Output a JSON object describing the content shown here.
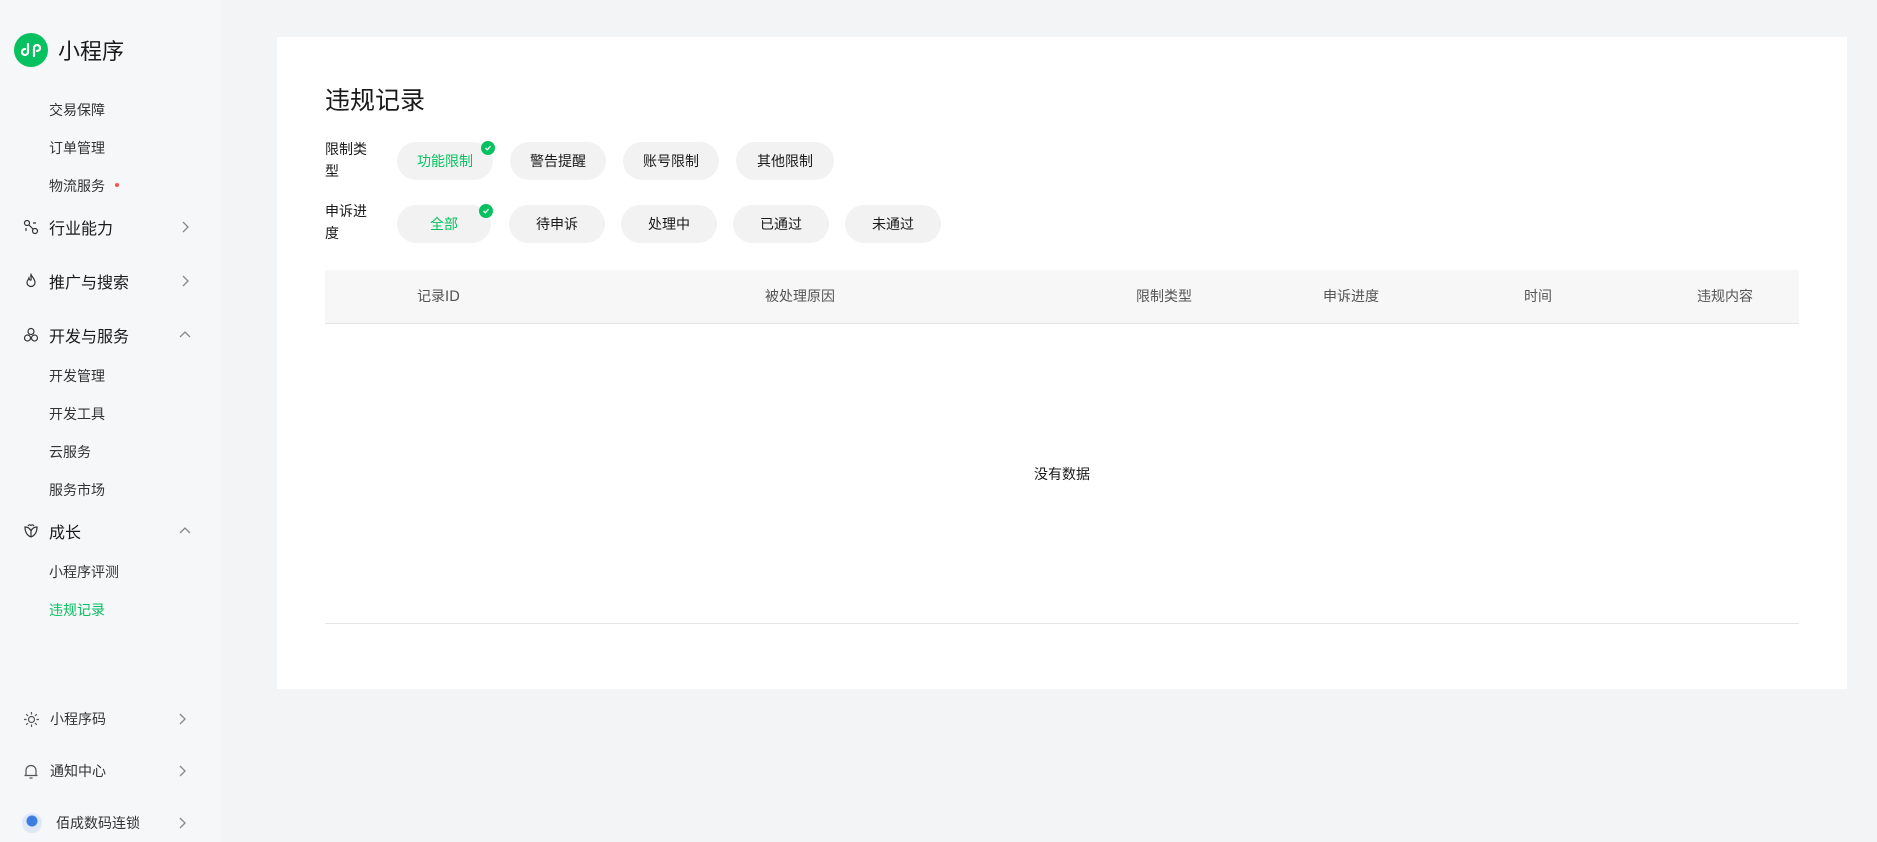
{
  "app": {
    "title": "小程序"
  },
  "sidebar": {
    "top_items": [
      {
        "label": "交易保障"
      },
      {
        "label": "订单管理"
      },
      {
        "label": "物流服务"
      }
    ],
    "groups": {
      "industry": {
        "label": "行业能力"
      },
      "promotion": {
        "label": "推广与搜索"
      },
      "dev": {
        "label": "开发与服务",
        "items": [
          {
            "label": "开发管理"
          },
          {
            "label": "开发工具"
          },
          {
            "label": "云服务"
          },
          {
            "label": "服务市场"
          }
        ]
      },
      "growth": {
        "label": "成长",
        "items": [
          {
            "label": "小程序评测"
          },
          {
            "label": "违规记录"
          }
        ]
      }
    },
    "bottom": {
      "qrcode": {
        "label": "小程序码"
      },
      "notify": {
        "label": "通知中心"
      },
      "account": {
        "label": "佰成数码连锁"
      }
    }
  },
  "page": {
    "title": "违规记录",
    "filters": {
      "restriction": {
        "label": "限制类型",
        "options": [
          "功能限制",
          "警告提醒",
          "账号限制",
          "其他限制"
        ],
        "selected": "功能限制"
      },
      "appeal": {
        "label": "申诉进度",
        "options": [
          "全部",
          "待申诉",
          "处理中",
          "已通过",
          "未通过"
        ],
        "selected": "全部"
      }
    },
    "table": {
      "columns": [
        "记录ID",
        "被处理原因",
        "限制类型",
        "申诉进度",
        "时间",
        "违规内容"
      ],
      "rows": [],
      "empty_text": "没有数据"
    }
  },
  "colors": {
    "accent": "#07c160",
    "alert": "#fa5151"
  }
}
